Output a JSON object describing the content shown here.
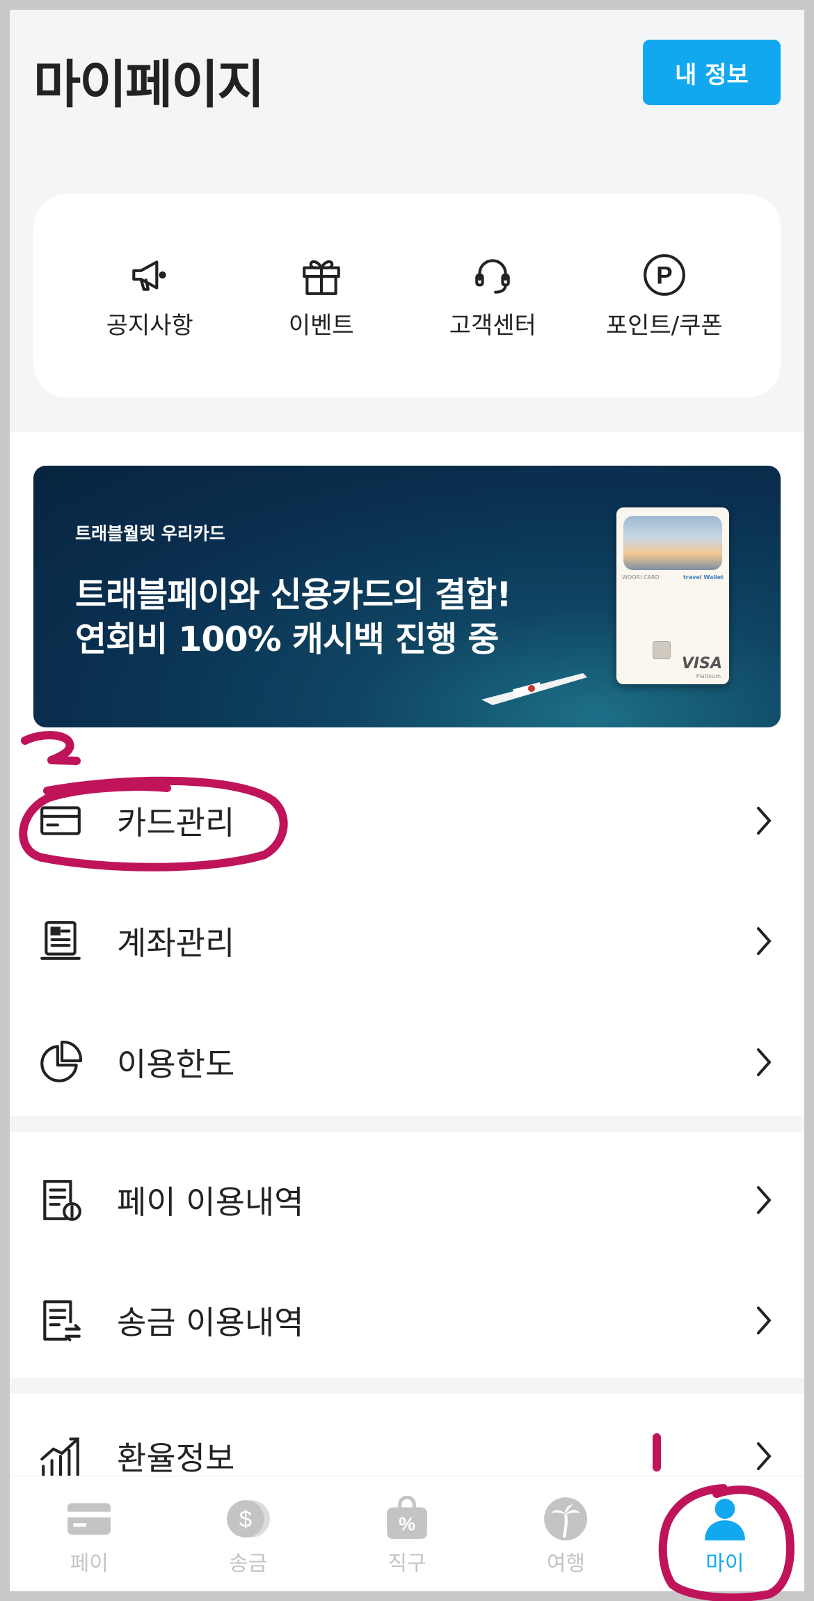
{
  "header": {
    "title": "마이페이지",
    "info_button": "내 정보"
  },
  "quick_menu": [
    {
      "label": "공지사항",
      "icon": "megaphone-icon"
    },
    {
      "label": "이벤트",
      "icon": "gift-icon"
    },
    {
      "label": "고객센터",
      "icon": "headset-icon"
    },
    {
      "label": "포인트/쿠폰",
      "icon": "point-icon"
    }
  ],
  "banner": {
    "subtitle": "트래블월렛 우리카드",
    "line1": "트래블페이와 신용카드의 결합!",
    "line2": "연회비 100% 캐시백 진행 중",
    "card_brand": "WOORI CARD",
    "card_wallet": "travel Wallet",
    "card_network": "VISA",
    "card_tier": "Platinum"
  },
  "menu": {
    "card": "카드관리",
    "account": "계좌관리",
    "limit": "이용한도",
    "pay_history": "페이 이용내역",
    "transfer_history": "송금 이용내역",
    "exchange": "환율정보"
  },
  "tabbar": [
    {
      "label": "페이",
      "icon": "card-icon",
      "active": false
    },
    {
      "label": "송금",
      "icon": "coin-icon",
      "active": false
    },
    {
      "label": "직구",
      "icon": "shopping-bag-icon",
      "active": false
    },
    {
      "label": "여행",
      "icon": "palm-tree-icon",
      "active": false
    },
    {
      "label": "마이",
      "icon": "person-icon",
      "active": true
    }
  ],
  "colors": {
    "accent": "#12a8f0",
    "annotation": "#c0145a",
    "inactive": "#c4c4c4"
  },
  "annotations": {
    "mark_1": "1",
    "mark_2": "2"
  }
}
